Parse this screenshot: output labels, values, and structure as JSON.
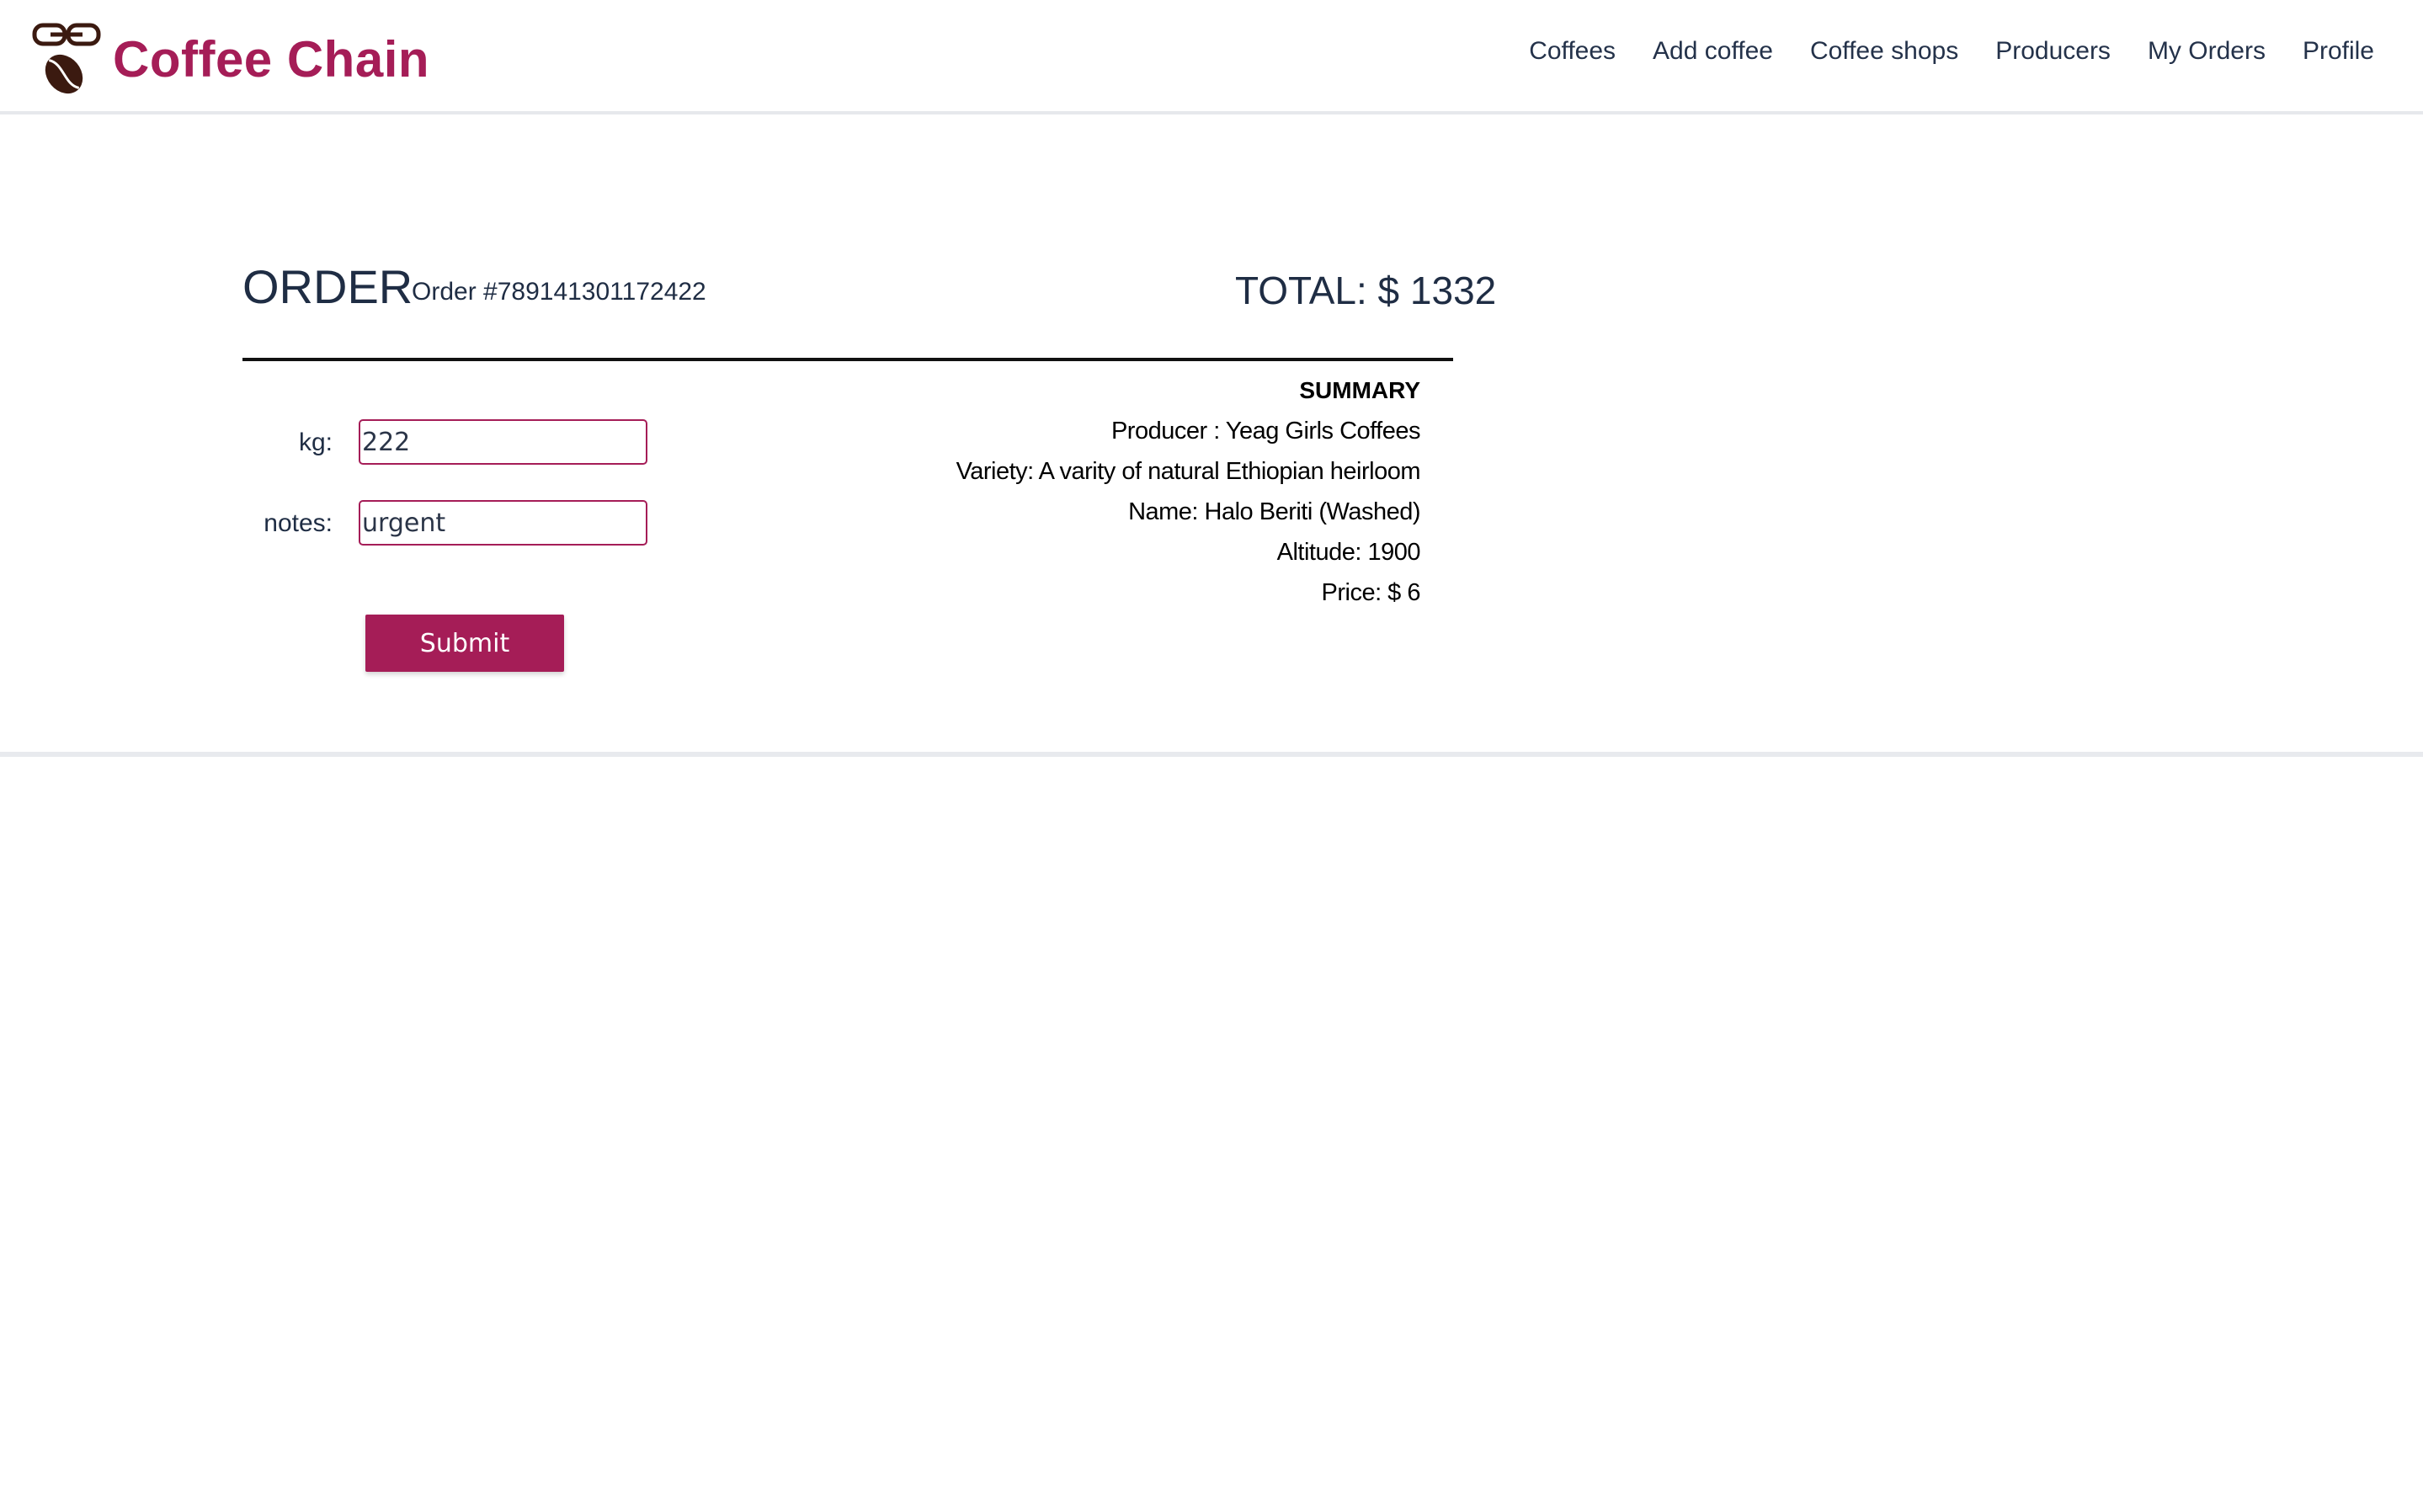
{
  "brand": {
    "name": "Coffee Chain",
    "color": "#a51d57",
    "logo_icon": "coffee-chain-logo-icon"
  },
  "nav": {
    "items": [
      {
        "label": "Coffees"
      },
      {
        "label": "Add coffee"
      },
      {
        "label": "Coffee shops"
      },
      {
        "label": "Producers"
      },
      {
        "label": "My Orders"
      },
      {
        "label": "Profile"
      }
    ]
  },
  "order": {
    "title": "ORDER",
    "number": "Order #789141301172422",
    "total": "TOTAL: $ 1332"
  },
  "form": {
    "kg_label": "kg:",
    "kg_value": "222",
    "notes_label": "notes:",
    "notes_value": "urgent",
    "submit_label": "Submit"
  },
  "summary": {
    "title": "SUMMARY",
    "producer": "Producer : Yeag Girls Coffees",
    "variety": "Variety: A varity of natural Ethiopian heirloom",
    "name": "Name: Halo Beriti (Washed)",
    "altitude": "Altitude: 1900",
    "price": "Price: $ 6"
  }
}
